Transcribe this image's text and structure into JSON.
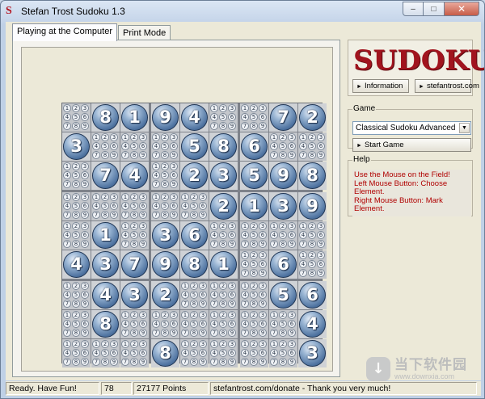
{
  "window": {
    "title": "Stefan Trost Sudoku 1.3",
    "minimize": "–",
    "maximize": "□",
    "close": "✕"
  },
  "tabs": [
    {
      "label": "Playing at the Computer",
      "active": true
    },
    {
      "label": "Print Mode",
      "active": false
    }
  ],
  "logo": {
    "text": "SUDOKU"
  },
  "links": {
    "information": "Information",
    "website": "stefantrost.com"
  },
  "game": {
    "label": "Game",
    "selected_mode": "Classical Sudoku Advanced",
    "start_button": "Start Game"
  },
  "help": {
    "label": "Help",
    "lines": [
      "Use the Mouse on the Field!",
      "Left Mouse Button: Choose Element.",
      "Right Mouse Button: Mark Element."
    ]
  },
  "status": {
    "message": "Ready. Have Fun!",
    "count": "78",
    "points": "27177 Points",
    "donate": "stefantrost.com/donate - Thank you very much!"
  },
  "board": {
    "grid": [
      [
        0,
        8,
        1,
        9,
        4,
        0,
        0,
        7,
        2
      ],
      [
        3,
        0,
        0,
        0,
        5,
        8,
        6,
        0,
        0
      ],
      [
        0,
        7,
        4,
        0,
        2,
        3,
        5,
        9,
        8
      ],
      [
        0,
        0,
        0,
        0,
        0,
        2,
        1,
        3,
        9
      ],
      [
        0,
        1,
        0,
        3,
        6,
        0,
        0,
        0,
        0
      ],
      [
        4,
        3,
        7,
        9,
        8,
        1,
        0,
        6,
        0
      ],
      [
        0,
        4,
        3,
        2,
        0,
        0,
        0,
        5,
        6
      ],
      [
        0,
        8,
        0,
        0,
        0,
        0,
        0,
        0,
        4
      ],
      [
        0,
        0,
        0,
        8,
        0,
        0,
        0,
        0,
        3
      ]
    ],
    "candidates": [
      "1",
      "2",
      "3",
      "4",
      "5",
      "6",
      "7",
      "8",
      "9"
    ]
  },
  "watermark": {
    "mark": "↓",
    "main": "当下软件园",
    "sub": "www.downxia.com"
  }
}
